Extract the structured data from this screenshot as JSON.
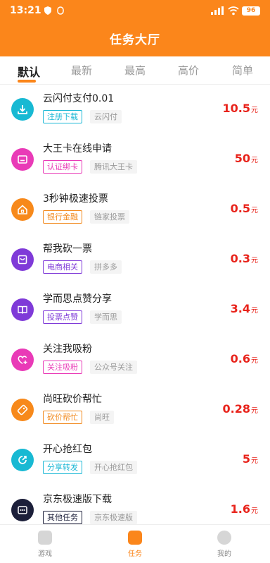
{
  "status_bar": {
    "time": "13:21",
    "battery": "96"
  },
  "header": {
    "title": "任务大厅"
  },
  "tabs": [
    {
      "label": "默认",
      "active": true
    },
    {
      "label": "最新",
      "active": false
    },
    {
      "label": "最高",
      "active": false
    },
    {
      "label": "高价",
      "active": false
    },
    {
      "label": "简单",
      "active": false
    }
  ],
  "tasks": [
    {
      "title": "云闪付支付0.01",
      "tag": "注册下载",
      "tag_color": "#1cb8d6",
      "sub_tag": "云闪付",
      "price": "10.5",
      "unit": "元",
      "icon": "download-icon",
      "icon_color": "#18b9d3"
    },
    {
      "title": "大王卡在线申请",
      "tag": "认证绑卡",
      "tag_color": "#e93ab7",
      "sub_tag": "腾讯大王卡",
      "price": "50",
      "unit": "元",
      "icon": "card-icon",
      "icon_color": "#e93ab7"
    },
    {
      "title": "3秒钟极速投票",
      "tag": "银行金融",
      "tag_color": "#f2891c",
      "sub_tag": "链家投票",
      "price": "0.5",
      "unit": "元",
      "icon": "home-icon",
      "icon_color": "#f7891b"
    },
    {
      "title": "帮我砍一票",
      "tag": "电商相关",
      "tag_color": "#7f3ad8",
      "sub_tag": "拼多多",
      "price": "0.3",
      "unit": "元",
      "icon": "bag-icon",
      "icon_color": "#7f3ad8"
    },
    {
      "title": "学而思点赞分享",
      "tag": "投票点赞",
      "tag_color": "#7f3ad8",
      "sub_tag": "学而思",
      "price": "3.4",
      "unit": "元",
      "icon": "book-icon",
      "icon_color": "#7f3ad8"
    },
    {
      "title": "关注我吸粉",
      "tag": "关注吸粉",
      "tag_color": "#e93ab7",
      "sub_tag": "公众号关注",
      "price": "0.6",
      "unit": "元",
      "icon": "heart-plus-icon",
      "icon_color": "#e93ab7"
    },
    {
      "title": "尚旺砍价帮忙",
      "tag": "砍价帮忙",
      "tag_color": "#f2891c",
      "sub_tag": "尚旺",
      "price": "0.28",
      "unit": "元",
      "icon": "tag-icon",
      "icon_color": "#f7891b"
    },
    {
      "title": "开心抢红包",
      "tag": "分享转发",
      "tag_color": "#1cb8d6",
      "sub_tag": "开心抢红包",
      "price": "5",
      "unit": "元",
      "icon": "share-icon",
      "icon_color": "#18b9d3"
    },
    {
      "title": "京东极速版下载",
      "tag": "其他任务",
      "tag_color": "#1c1f3a",
      "sub_tag": "京东极速版",
      "price": "1.6",
      "unit": "元",
      "icon": "chat-icon",
      "icon_color": "#1c1f3a"
    }
  ],
  "bottom_nav": [
    {
      "label": "游戏",
      "icon": "game-icon",
      "active": false
    },
    {
      "label": "任务",
      "icon": "task-icon",
      "active": true
    },
    {
      "label": "我的",
      "icon": "profile-icon",
      "active": false
    }
  ],
  "colors": {
    "accent": "#fb861b",
    "price": "#e8231b"
  }
}
